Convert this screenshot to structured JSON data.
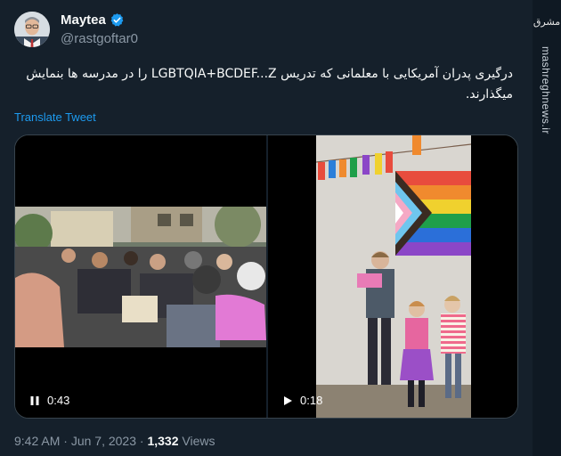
{
  "author": {
    "display_name": "Maytea",
    "handle": "@rastgoftar0",
    "verified": true
  },
  "tweet": {
    "text_line1": "درگیری پدران آمریکایی با معلمانی که تدریس LGBTQIA+BCDEF...Z را در مدرسه ها بنمایش",
    "text_line2": "میگذارند.",
    "translate_label": "Translate Tweet"
  },
  "media": {
    "video1": {
      "duration": "0:43",
      "control": "pause-icon"
    },
    "video2": {
      "duration": "0:18",
      "control": "play-icon"
    }
  },
  "meta": {
    "time": "9:42 AM",
    "separator": "·",
    "date": "Jun 7, 2023",
    "views_count": "1,332",
    "views_label": "Views"
  },
  "watermark": {
    "logo_text": "مشرق",
    "site": "mashreghnews.ir"
  },
  "colors": {
    "background": "#15202b",
    "link": "#1d9bf0",
    "secondary_text": "#8b98a5",
    "verified": "#1d9bf0"
  }
}
